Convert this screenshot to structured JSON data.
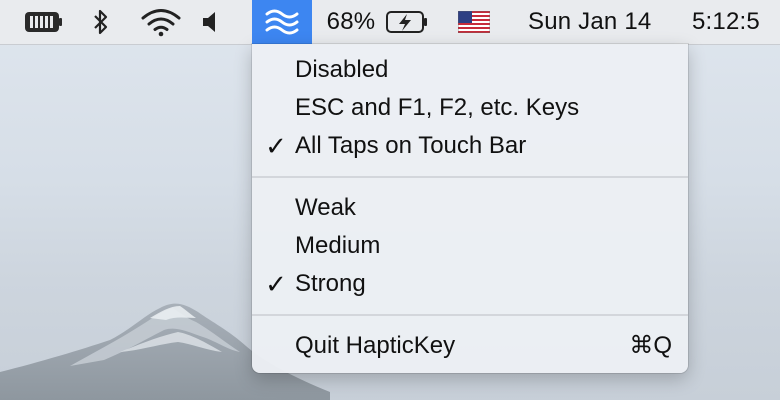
{
  "menubar": {
    "battery_percent": "68%",
    "date": "Sun Jan 14",
    "time": "5:12:5",
    "icons": [
      "battery-meter-icon",
      "bluetooth-icon",
      "wifi-icon",
      "volume-icon",
      "haptickey-icon",
      "battery-charging-icon",
      "us-flag-icon"
    ],
    "accent_color": "#3d86f1"
  },
  "menu": {
    "mode_items": [
      {
        "label": "Disabled",
        "checked": false
      },
      {
        "label": "ESC and F1, F2, etc. Keys",
        "checked": false
      },
      {
        "label": "All Taps on Touch Bar",
        "checked": true
      }
    ],
    "strength_items": [
      {
        "label": "Weak",
        "checked": false
      },
      {
        "label": "Medium",
        "checked": false
      },
      {
        "label": "Strong",
        "checked": true
      }
    ],
    "quit": {
      "label": "Quit HapticKey",
      "shortcut": "⌘Q"
    },
    "check_glyph": "✓"
  }
}
